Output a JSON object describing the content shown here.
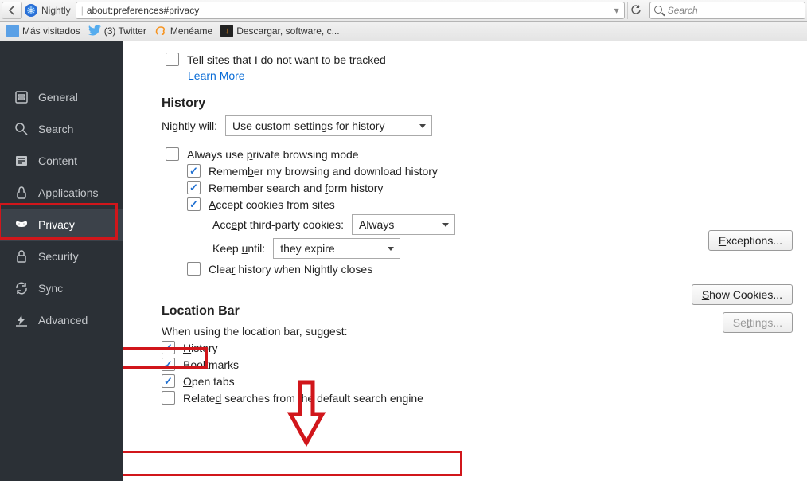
{
  "toolbar": {
    "identity": "Nightly",
    "url": "about:preferences#privacy",
    "search_placeholder": "Search"
  },
  "bookmarks": [
    {
      "label": "Más visitados",
      "icon": "blue"
    },
    {
      "label": "(3) Twitter",
      "icon": "twitter"
    },
    {
      "label": "Menéame",
      "icon": "meneame"
    },
    {
      "label": "Descargar, software, c...",
      "icon": "dark"
    }
  ],
  "sidebar": {
    "items": [
      {
        "id": "general",
        "label": "General"
      },
      {
        "id": "search",
        "label": "Search"
      },
      {
        "id": "content",
        "label": "Content"
      },
      {
        "id": "applications",
        "label": "Applications"
      },
      {
        "id": "privacy",
        "label": "Privacy"
      },
      {
        "id": "security",
        "label": "Security"
      },
      {
        "id": "sync",
        "label": "Sync"
      },
      {
        "id": "advanced",
        "label": "Advanced"
      }
    ],
    "active": "privacy"
  },
  "tracking": {
    "dnt_label": "Tell sites that I do not want to be tracked",
    "learn_more": "Learn More"
  },
  "history": {
    "title": "History",
    "will_label": "Nightly will:",
    "will_value": "Use custom settings for history",
    "always_private": "Always use private browsing mode",
    "remember_browsing": "Remember my browsing and download history",
    "remember_search": "Remember search and form history",
    "accept_cookies": "Accept cookies from sites",
    "third_party_label": "Accept third-party cookies:",
    "third_party_value": "Always",
    "keep_until_label": "Keep until:",
    "keep_until_value": "they expire",
    "clear_on_close": "Clear history when Nightly closes",
    "exceptions_btn": "Exceptions...",
    "show_cookies_btn": "Show Cookies...",
    "settings_btn": "Settings..."
  },
  "location_bar": {
    "title": "Location Bar",
    "when_using": "When using the location bar, suggest:",
    "history": "History",
    "bookmarks": "Bookmarks",
    "open_tabs": "Open tabs",
    "related_searches": "Related searches from the default search engine"
  }
}
